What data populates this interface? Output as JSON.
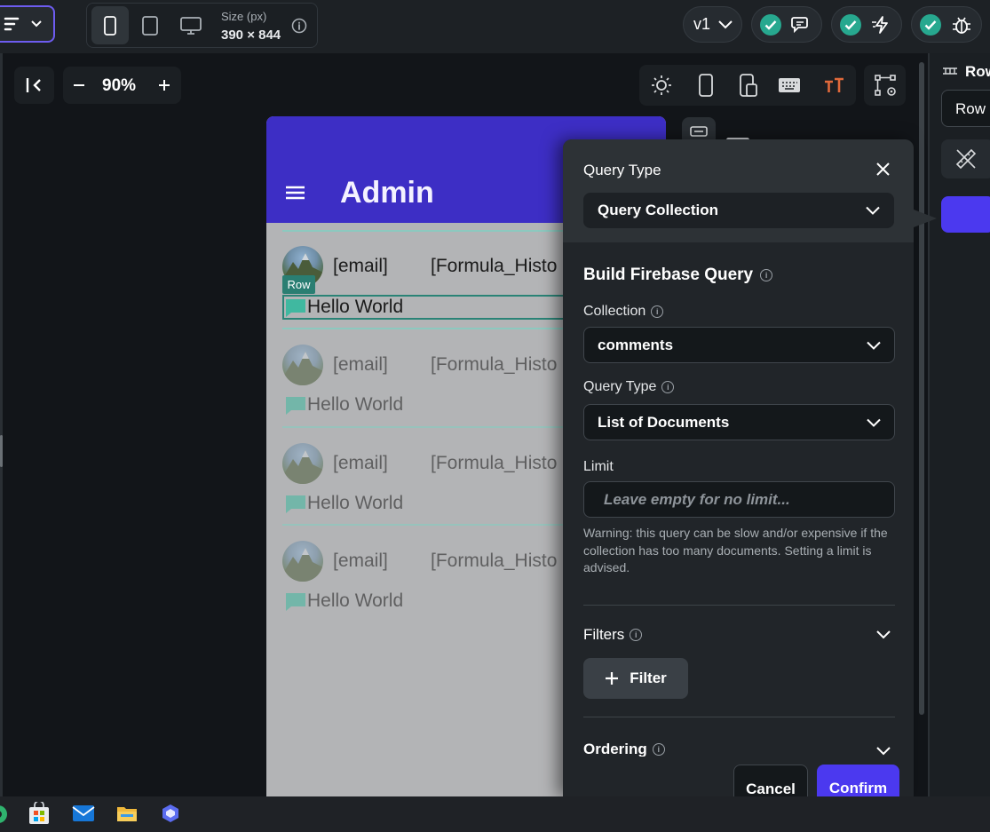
{
  "toolbar": {
    "size_label": "Size (px)",
    "size_value": "390 × 844",
    "version": "v1"
  },
  "canvas": {
    "zoom": "90%"
  },
  "phone": {
    "title": "Admin",
    "rows": [
      {
        "email": "[email]",
        "formula": "[Formula_Histo",
        "message": "Hello World"
      },
      {
        "email": "[email]",
        "formula": "[Formula_Histo",
        "message": "Hello World"
      },
      {
        "email": "[email]",
        "formula": "[Formula_Histo",
        "message": "Hello World"
      },
      {
        "email": "[email]",
        "formula": "[Formula_Histo",
        "message": "Hello World"
      }
    ],
    "selection_tag": "Row"
  },
  "modal": {
    "query_type_label": "Query Type",
    "query_type_value": "Query Collection",
    "section_title": "Build Firebase Query",
    "collection_label": "Collection",
    "collection_value": "comments",
    "query_type2_label": "Query Type",
    "query_type2_value": "List of Documents",
    "limit_label": "Limit",
    "limit_placeholder": "Leave empty for no limit...",
    "warning": "Warning: this query can be slow and/or expensive if the collection has too many documents. Setting a limit is advised.",
    "filters_label": "Filters",
    "filter_button": "Filter",
    "ordering_label": "Ordering",
    "cancel": "Cancel",
    "confirm": "Confirm"
  },
  "right_panel": {
    "header": "Row",
    "select_value": "Row"
  },
  "colors": {
    "accent": "#4b39ef",
    "appbar": "#3d2ec5",
    "teal": "#249689"
  }
}
